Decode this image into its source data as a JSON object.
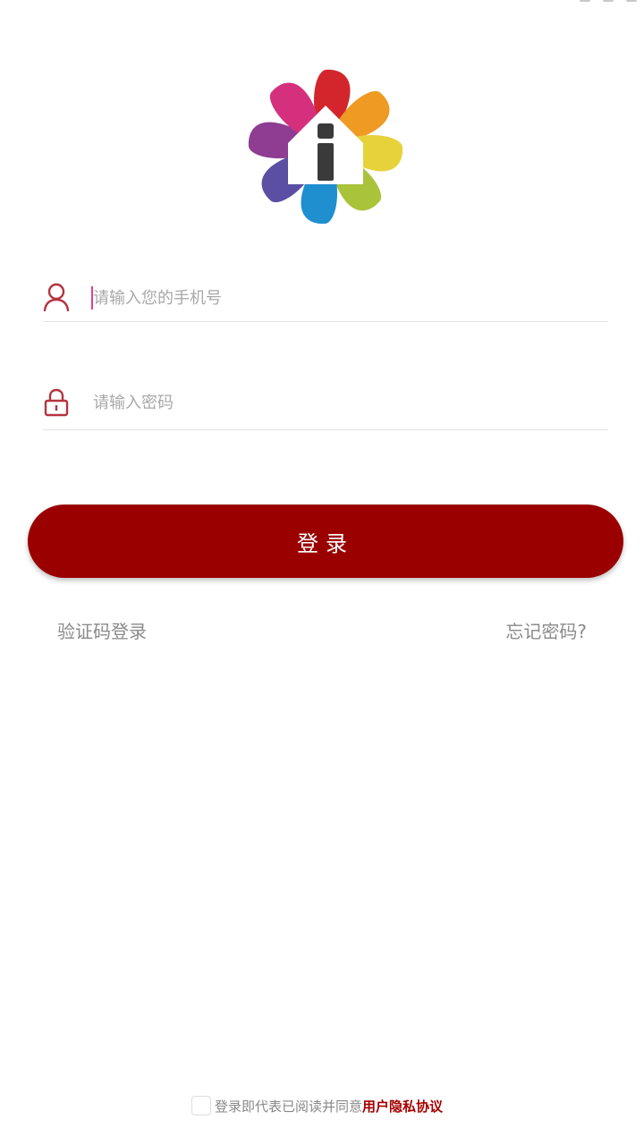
{
  "login_form": {
    "phone_placeholder": "请输入您的手机号",
    "password_placeholder": "请输入密码",
    "login_button_label": "登录",
    "sms_login_link": "验证码登录",
    "forgot_password_link": "忘记密码?"
  },
  "agreement": {
    "prefix_text": "登录即代表已阅读并同意",
    "policy_link": "用户隐私协议"
  },
  "colors": {
    "brand": "#9a0000",
    "input_icon": "#b3343f",
    "link_accent": "#a40000"
  },
  "icons": {
    "phone_field": "user-icon",
    "password_field": "lock-icon"
  }
}
